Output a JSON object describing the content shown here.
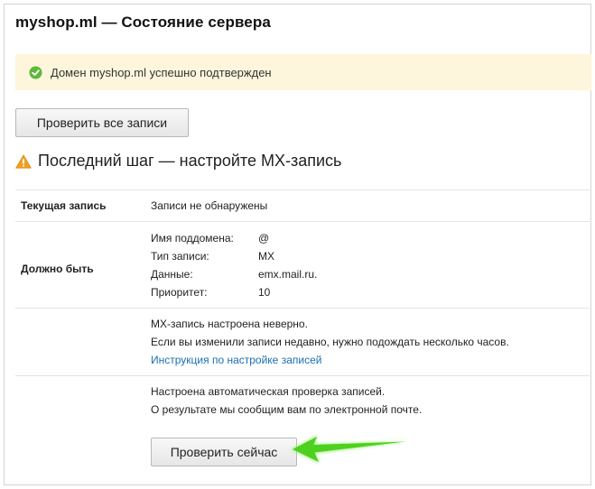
{
  "header": {
    "title": "myshop.ml — Состояние сервера"
  },
  "notice": {
    "text": "Домен myshop.ml успешно подтвержден",
    "icon": "check-circle-icon",
    "color": "#5db93a",
    "bg": "#fdf6dc"
  },
  "buttons": {
    "check_all": "Проверить все записи",
    "check_now": "Проверить сейчас"
  },
  "step": {
    "text": "Последний шаг — настройте MX-запись",
    "icon": "warning-icon",
    "color": "#f0a020"
  },
  "table": {
    "current": {
      "label": "Текущая запись",
      "value": "Записи не обнаружены"
    },
    "expected": {
      "label": "Должно быть",
      "fields": [
        {
          "key": "Имя поддомена:",
          "value": "@"
        },
        {
          "key": "Тип записи:",
          "value": "MX"
        },
        {
          "key": "Данные:",
          "value": "emx.mail.ru."
        },
        {
          "key": "Приоритет:",
          "value": "10"
        }
      ]
    },
    "error": {
      "line1": "MX-запись настроена неверно.",
      "line2": "Если вы изменили записи недавно, нужно подождать несколько часов.",
      "link": "Инструкция по настройке записей"
    },
    "auto": {
      "line1": "Настроена автоматическая проверка записей.",
      "line2": "О результате мы сообщим вам по электронной почте."
    }
  },
  "annotation": {
    "icon": "green-arrow-icon",
    "color": "#4ed11e"
  }
}
